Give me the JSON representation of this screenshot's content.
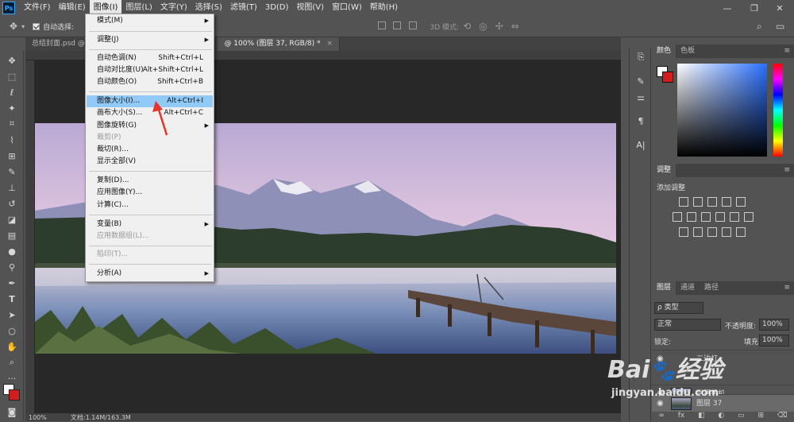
{
  "menubar": {
    "logo": "Ps",
    "items": [
      "文件(F)",
      "编辑(E)",
      "图像(I)",
      "图层(L)",
      "文字(Y)",
      "选择(S)",
      "滤镜(T)",
      "3D(D)",
      "视图(V)",
      "窗口(W)",
      "帮助(H)"
    ],
    "active_index": 2
  },
  "window_controls": {
    "minimize": "—",
    "restore": "❐",
    "close": "✕"
  },
  "options_bar": {
    "auto_select_label": "自动选择:",
    "mode_3d_label": "3D 模式:"
  },
  "tabs": [
    {
      "label": "总结封面.psd @ 5",
      "active": false
    },
    {
      "label": "@ 100% (图层 37, RGB/8) *",
      "active": true
    }
  ],
  "tab_close": "×",
  "status_bar": {
    "zoom": "100%",
    "doc_info": "文档:1.14M/163.3M"
  },
  "image_menu": {
    "items": [
      {
        "label": "模式(M)",
        "shortcut": "",
        "submenu": true,
        "disabled": false,
        "highlight": false
      },
      {
        "label": "调整(J)",
        "shortcut": "",
        "submenu": true,
        "disabled": false,
        "highlight": false
      },
      {
        "label": "自动色调(N)",
        "shortcut": "Shift+Ctrl+L",
        "submenu": false,
        "disabled": false,
        "highlight": false
      },
      {
        "label": "自动对比度(U)",
        "shortcut": "Alt+Shift+Ctrl+L",
        "submenu": false,
        "disabled": false,
        "highlight": false
      },
      {
        "label": "自动颜色(O)",
        "shortcut": "Shift+Ctrl+B",
        "submenu": false,
        "disabled": false,
        "highlight": false
      },
      {
        "label": "图像大小(I)...",
        "shortcut": "Alt+Ctrl+I",
        "submenu": false,
        "disabled": false,
        "highlight": true
      },
      {
        "label": "画布大小(S)...",
        "shortcut": "Alt+Ctrl+C",
        "submenu": false,
        "disabled": false,
        "highlight": false
      },
      {
        "label": "图像旋转(G)",
        "shortcut": "",
        "submenu": true,
        "disabled": false,
        "highlight": false
      },
      {
        "label": "裁剪(P)",
        "shortcut": "",
        "submenu": false,
        "disabled": true,
        "highlight": false
      },
      {
        "label": "裁切(R)...",
        "shortcut": "",
        "submenu": false,
        "disabled": false,
        "highlight": false
      },
      {
        "label": "显示全部(V)",
        "shortcut": "",
        "submenu": false,
        "disabled": false,
        "highlight": false
      },
      {
        "label": "复制(D)...",
        "shortcut": "",
        "submenu": false,
        "disabled": false,
        "highlight": false
      },
      {
        "label": "应用图像(Y)...",
        "shortcut": "",
        "submenu": false,
        "disabled": false,
        "highlight": false
      },
      {
        "label": "计算(C)...",
        "shortcut": "",
        "submenu": false,
        "disabled": false,
        "highlight": false
      },
      {
        "label": "变量(B)",
        "shortcut": "",
        "submenu": true,
        "disabled": false,
        "highlight": false
      },
      {
        "label": "应用数据组(L)...",
        "shortcut": "",
        "submenu": false,
        "disabled": true,
        "highlight": false
      },
      {
        "label": "陷印(T)...",
        "shortcut": "",
        "submenu": false,
        "disabled": true,
        "highlight": false
      },
      {
        "label": "分析(A)",
        "shortcut": "",
        "submenu": true,
        "disabled": false,
        "highlight": false
      }
    ]
  },
  "color_panel": {
    "tabs": [
      "颜色",
      "色板"
    ]
  },
  "adjust_panel": {
    "title": "调整",
    "subtitle": "添加调整"
  },
  "layers_panel": {
    "tabs": [
      "图层",
      "通道",
      "路径"
    ],
    "filter_label": "ρ 类型",
    "blend_mode": "正常",
    "opacity_label": "不透明度:",
    "opacity_value": "100%",
    "lock_label": "锁定:",
    "fill_label": "填充:",
    "fill_value": "100%",
    "layers": [
      {
        "name": "二边灯"
      },
      {
        "name": "拔罩手机"
      },
      {
        "name": "图层 37"
      }
    ]
  },
  "colors": {
    "highlight": "#91c9f7",
    "arrow": "#e8332a",
    "panel_bg": "#535353"
  },
  "watermark": {
    "brand": "Bai",
    "brand2": "经验",
    "url": "jingyan.baidu.com"
  }
}
